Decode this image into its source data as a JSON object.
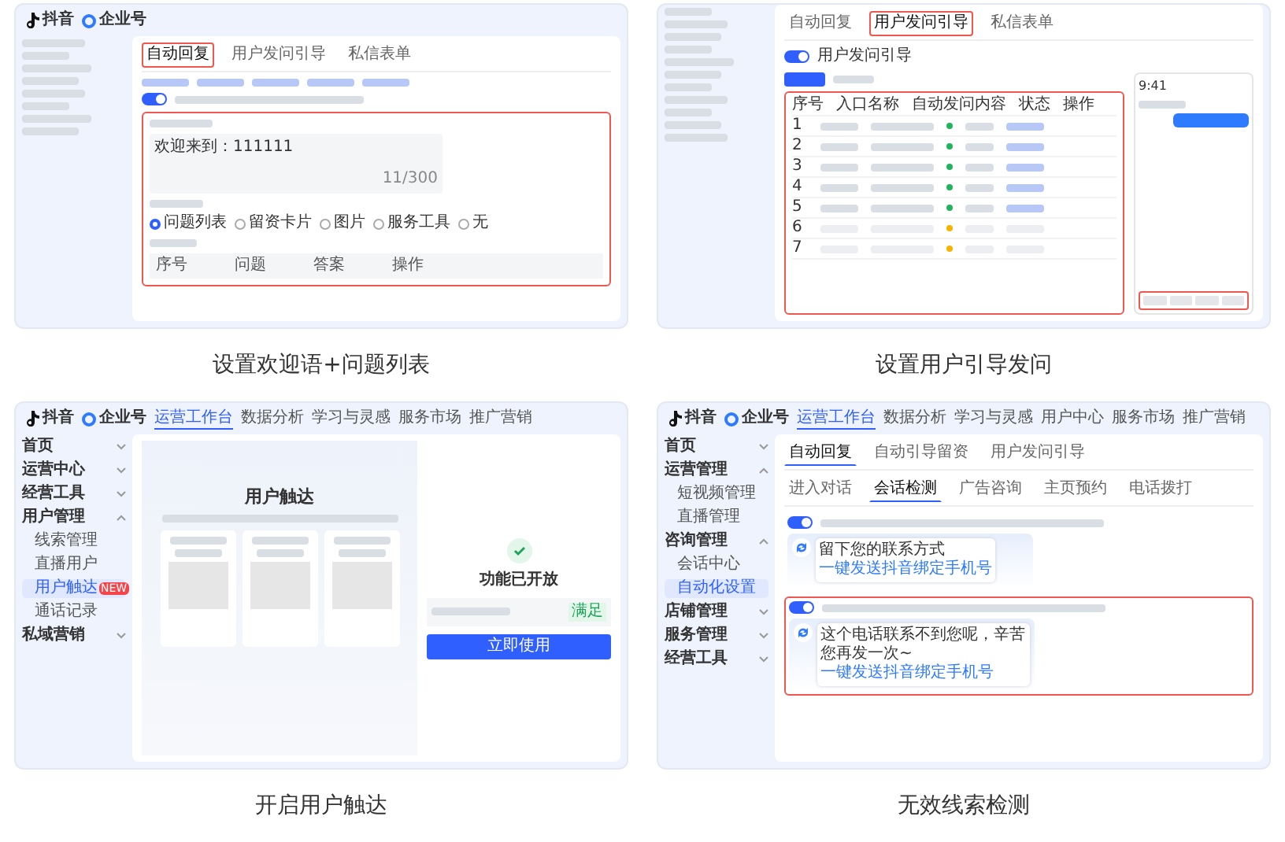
{
  "panels": [
    {
      "kind": "welcome",
      "caption": "设置欢迎语+问题列表",
      "logo": "抖音",
      "brand": "企业号",
      "tabs": [
        {
          "label": "自动回复",
          "selected": true
        },
        {
          "label": "用户发问引导",
          "selected": false
        },
        {
          "label": "私信表单",
          "selected": false
        }
      ],
      "toggle": {
        "on": true
      },
      "editor": {
        "value": "欢迎来到：111111",
        "count": "11/300"
      },
      "options": [
        {
          "label": "问题列表",
          "selected": true
        },
        {
          "label": "留资卡片",
          "selected": false
        },
        {
          "label": "图片",
          "selected": false
        },
        {
          "label": "服务工具",
          "selected": false
        },
        {
          "label": "无",
          "selected": false
        }
      ],
      "columns": [
        "序号",
        "问题",
        "答案",
        "操作"
      ]
    },
    {
      "kind": "guide",
      "caption": "设置用户引导发问",
      "tabs": [
        {
          "label": "自动回复",
          "selected": false
        },
        {
          "label": "用户发问引导",
          "selected": true
        },
        {
          "label": "私信表单",
          "selected": false
        }
      ],
      "toggle": {
        "on": true,
        "label": "用户发问引导"
      },
      "columns": [
        "序号",
        "入口名称",
        "自动发问内容",
        "状态",
        "操作"
      ],
      "rows": [
        {
          "index": "1",
          "disabled": false,
          "color": "#22b35e"
        },
        {
          "index": "2",
          "disabled": false,
          "color": "#22b35e"
        },
        {
          "index": "3",
          "disabled": false,
          "color": "#22b35e"
        },
        {
          "index": "4",
          "disabled": false,
          "color": "#22b35e"
        },
        {
          "index": "5",
          "disabled": false,
          "color": "#22b35e"
        },
        {
          "index": "6",
          "disabled": true,
          "color": "#f5b400"
        },
        {
          "index": "7",
          "disabled": true,
          "color": "#f5b400"
        }
      ],
      "phone_time": "9:41"
    },
    {
      "kind": "reach",
      "caption": "开启用户触达",
      "logo": "抖音",
      "brand": "企业号",
      "nav": [
        {
          "label": "运营工作台",
          "selected": true
        },
        {
          "label": "数据分析",
          "selected": false
        },
        {
          "label": "学习与灵感",
          "selected": false
        },
        {
          "label": "服务市场",
          "selected": false
        },
        {
          "label": "推广营销",
          "selected": false
        }
      ],
      "sidebar": [
        {
          "label": "首页",
          "expanded": false
        },
        {
          "label": "运营中心",
          "expanded": false
        },
        {
          "label": "经营工具",
          "expanded": false
        },
        {
          "label": "用户管理",
          "expanded": true,
          "children": [
            {
              "label": "线索管理",
              "selected": false
            },
            {
              "label": "直播用户",
              "selected": false
            },
            {
              "label": "用户触达",
              "selected": true,
              "badge": "NEW"
            },
            {
              "label": "通话记录",
              "selected": false
            }
          ]
        },
        {
          "label": "私域营销",
          "expanded": false
        }
      ],
      "title": "用户触达",
      "status": "功能已开放",
      "tag": "满足",
      "action": "立即使用"
    },
    {
      "kind": "detect",
      "caption": "无效线索检测",
      "logo": "抖音",
      "brand": "企业号",
      "nav": [
        {
          "label": "运营工作台",
          "selected": true
        },
        {
          "label": "数据分析",
          "selected": false
        },
        {
          "label": "学习与灵感",
          "selected": false
        },
        {
          "label": "用户中心",
          "selected": false
        },
        {
          "label": "服务市场",
          "selected": false
        },
        {
          "label": "推广营销",
          "selected": false
        }
      ],
      "sidebar": [
        {
          "label": "首页",
          "expanded": false
        },
        {
          "label": "运营管理",
          "expanded": true,
          "children": [
            {
              "label": "短视频管理",
              "selected": false
            },
            {
              "label": "直播管理",
              "selected": false
            }
          ]
        },
        {
          "label": "咨询管理",
          "expanded": true,
          "children": [
            {
              "label": "会话中心",
              "selected": false
            },
            {
              "label": "自动化设置",
              "selected": true
            }
          ]
        },
        {
          "label": "店铺管理",
          "expanded": false
        },
        {
          "label": "服务管理",
          "expanded": false
        },
        {
          "label": "经营工具",
          "expanded": false
        }
      ],
      "tabs": [
        {
          "label": "自动回复",
          "selected": true
        },
        {
          "label": "自动引导留资",
          "selected": false
        },
        {
          "label": "用户发问引导",
          "selected": false
        }
      ],
      "subtabs": [
        {
          "label": "进入对话",
          "selected": false
        },
        {
          "label": "会话检测",
          "selected": true
        },
        {
          "label": "广告咨询",
          "selected": false
        },
        {
          "label": "主页预约",
          "selected": false
        },
        {
          "label": "电话拨打",
          "selected": false
        }
      ],
      "toggles": [
        {
          "on": true,
          "bubbles": [
            {
              "text": "留下您的联系方式",
              "link": "一键发送抖音绑定手机号"
            }
          ]
        },
        {
          "on": true,
          "bubbles": [
            {
              "text": "这个电话联系不到您呢，辛苦您再发一次~",
              "link": "一键发送抖音绑定手机号"
            }
          ]
        }
      ]
    }
  ]
}
